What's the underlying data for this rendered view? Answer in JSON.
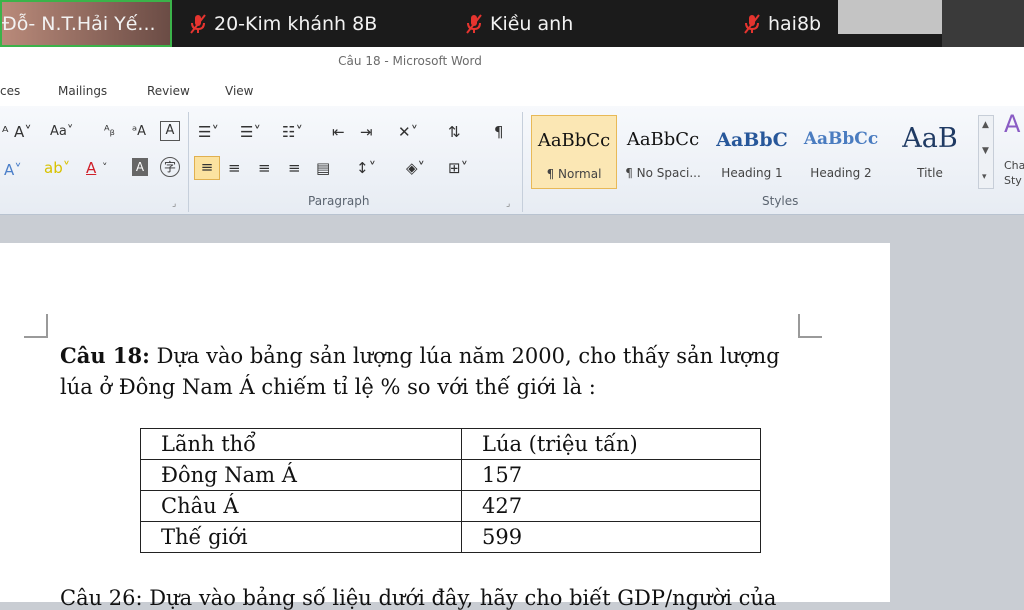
{
  "participants": [
    {
      "name": "Đỗ- N.T.Hải Yế...",
      "muted": false
    },
    {
      "name": "20-Kim khánh 8B",
      "muted": true
    },
    {
      "name": "Kiều anh",
      "muted": true
    },
    {
      "name": "hai8b",
      "muted": true
    }
  ],
  "window": {
    "title": "Câu 18 - Microsoft Word"
  },
  "ribbon_tabs": [
    "ces",
    "Mailings",
    "Review",
    "View"
  ],
  "ribbon_groups": {
    "paragraph": "Paragraph",
    "styles": "Styles"
  },
  "styles": [
    {
      "sample": "AaBbCc",
      "name": "¶ Normal",
      "selected": true
    },
    {
      "sample": "AaBbCc",
      "name": "¶ No Spaci..."
    },
    {
      "sample": "AaBbC",
      "name": "Heading 1"
    },
    {
      "sample": "AaBbCc",
      "name": "Heading 2"
    },
    {
      "sample": "AaB",
      "name": "Title"
    }
  ],
  "change_styles_label": "Cha Sty",
  "document": {
    "question_label": "Câu 18:",
    "question_text": " Dựa vào bảng sản lượng lúa năm 2000, cho thấy sản lượng lúa ở Đông Nam Á chiếm tỉ lệ % so với thế giới là :",
    "table": {
      "headers": [
        "Lãnh thổ",
        "Lúa (triệu tấn)"
      ],
      "rows": [
        [
          "Đông Nam Á",
          "157"
        ],
        [
          "Châu Á",
          "427"
        ],
        [
          "Thế giới",
          "599"
        ]
      ]
    },
    "next_question": "Câu 26: Dựa vào bảng số liệu dưới đây, hãy cho biết GDP/người của"
  },
  "colors": {
    "zoom_bar": "#1b1b1b",
    "mic_muted": "#e5342f",
    "style_selected": "#fbe7b4"
  }
}
